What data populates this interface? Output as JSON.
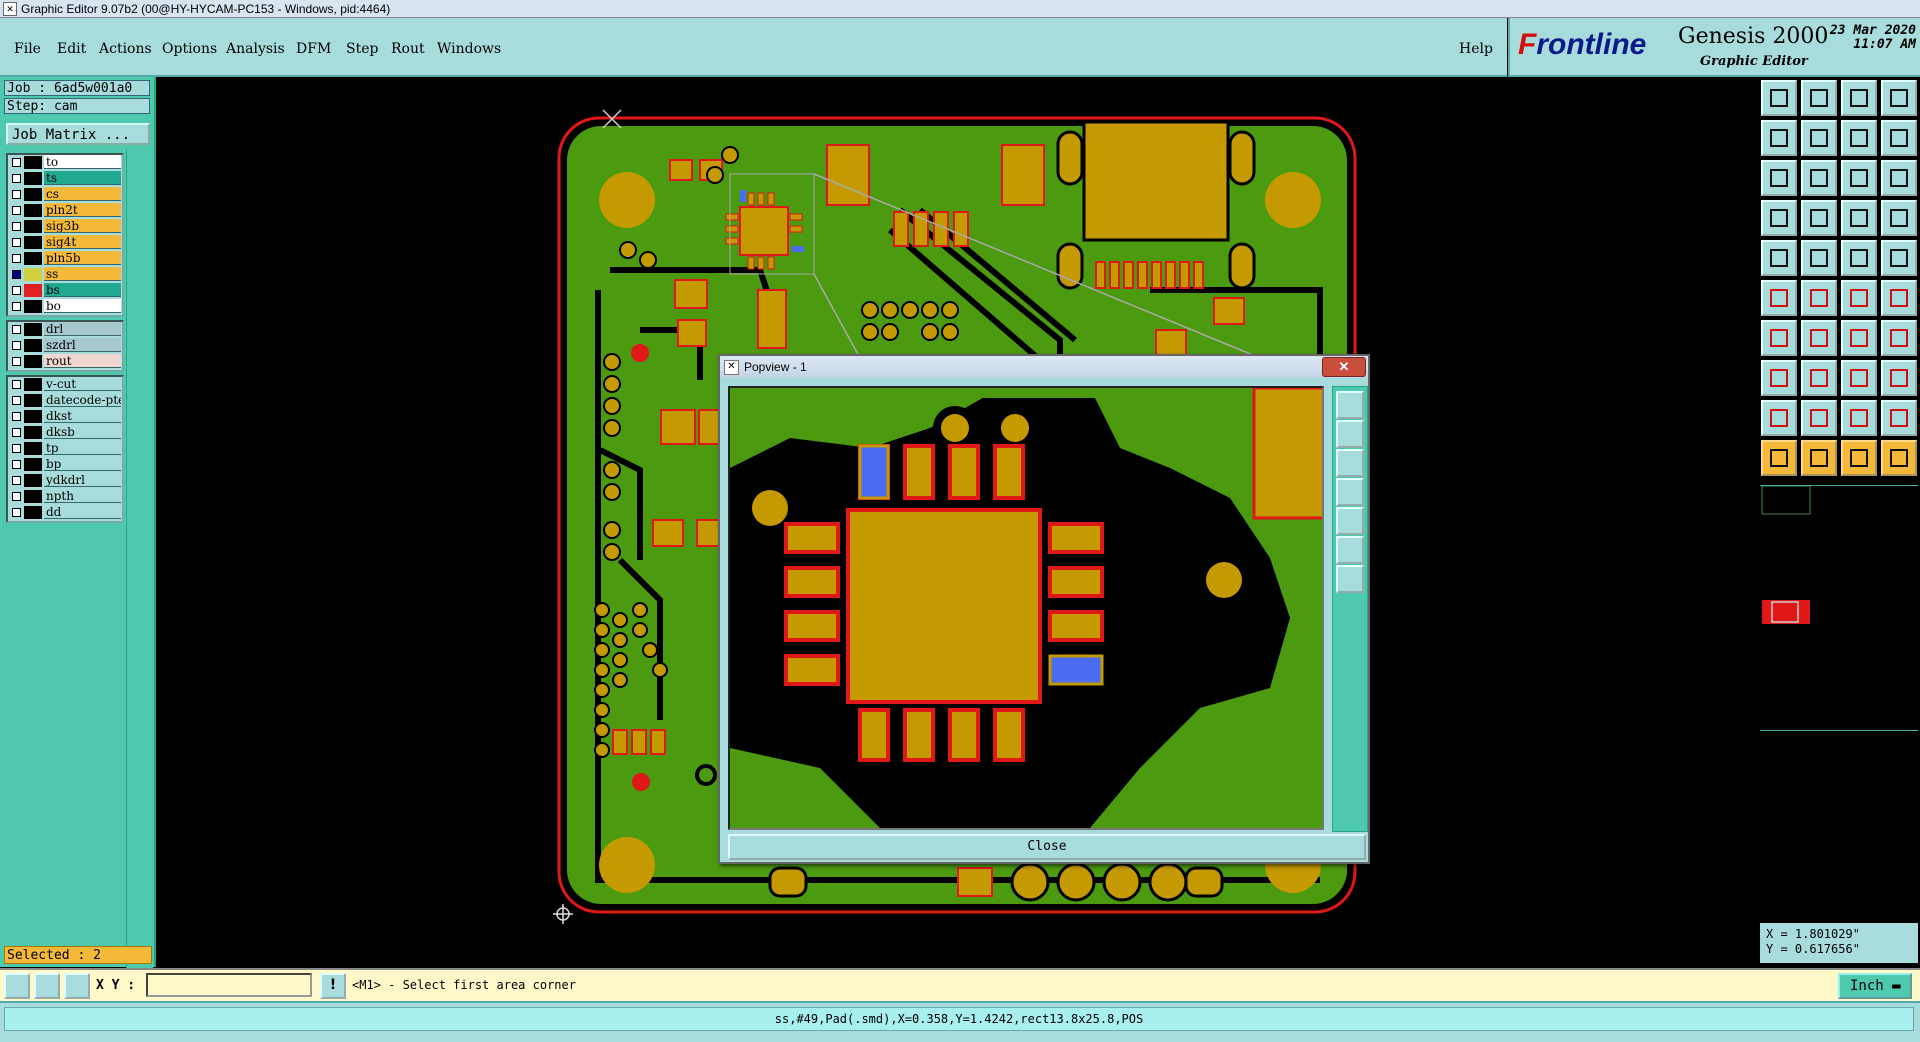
{
  "window": {
    "title": "Graphic Editor 9.07b2 (00@HY-HYCAM-PC153 - Windows, pid:4464)"
  },
  "menu": {
    "items": [
      "File",
      "Edit",
      "Actions",
      "Options",
      "Analysis",
      "DFM",
      "Step",
      "Rout",
      "Windows"
    ],
    "help": "Help"
  },
  "brand": {
    "logo_f": "F",
    "logo_rest": "rontline",
    "product": "Genesis 2000",
    "subtitle": "Graphic Editor",
    "date": "23 Mar 2020",
    "time": "11:07 AM"
  },
  "job": {
    "job_label": "Job : 6ad5w001a0",
    "step_label": "Step: cam",
    "matrix_button": "Job Matrix ..."
  },
  "layers": {
    "group1": [
      {
        "name": "to",
        "color": "#ffffff",
        "checked": false,
        "swatch": ""
      },
      {
        "name": "ts",
        "color": "#20a890",
        "checked": false,
        "swatch": ""
      },
      {
        "name": "cs",
        "color": "#f5b93a",
        "checked": false,
        "swatch": ""
      },
      {
        "name": "pln2t",
        "color": "#f5b93a",
        "checked": false,
        "swatch": ""
      },
      {
        "name": "sig3b",
        "color": "#f5b93a",
        "checked": false,
        "swatch": ""
      },
      {
        "name": "sig4t",
        "color": "#f5b93a",
        "checked": false,
        "swatch": ""
      },
      {
        "name": "pln5b",
        "color": "#f5b93a",
        "checked": false,
        "swatch": ""
      },
      {
        "name": "ss",
        "color": "#f5b93a",
        "checked": true,
        "swatch": "#d0d040"
      },
      {
        "name": "bs",
        "color": "#20a890",
        "checked": false,
        "swatch": "#e02020"
      },
      {
        "name": "bo",
        "color": "#ffffff",
        "checked": false,
        "swatch": ""
      }
    ],
    "group2": [
      {
        "name": "drl",
        "color": "#a8c8d0"
      },
      {
        "name": "szdrl",
        "color": "#a8c8d0"
      },
      {
        "name": "rout",
        "color": "#f0d8d0"
      }
    ],
    "group3": [
      {
        "name": "v-cut",
        "color": "#a8dcdc"
      },
      {
        "name": "datecode-pte",
        "color": "#a8dcdc"
      },
      {
        "name": "dkst",
        "color": "#a8dcdc"
      },
      {
        "name": "dksb",
        "color": "#a8dcdc"
      },
      {
        "name": "tp",
        "color": "#a8dcdc"
      },
      {
        "name": "bp",
        "color": "#a8dcdc"
      },
      {
        "name": "ydkdrl",
        "color": "#a8dcdc"
      },
      {
        "name": "npth",
        "color": "#a8dcdc"
      },
      {
        "name": "dd",
        "color": "#a8dcdc"
      }
    ]
  },
  "selection": {
    "label": "Selected : 2"
  },
  "popview": {
    "title": "Popview - 1",
    "close_label": "Close"
  },
  "coords": {
    "x": "X = 1.801029\"",
    "y": "Y = 0.617656\""
  },
  "cmdbar": {
    "xy_label": "X Y :",
    "xy_value": "",
    "prompt": "<M1> - Select first area corner",
    "units": "Inch"
  },
  "status": {
    "text": "ss,#49,Pad(.smd),X=0.358,Y=1.4242,rect13.8x25.8,POS"
  },
  "colors": {
    "board": "#4c9a10",
    "copper": "#c49a00",
    "outline": "#e01818",
    "selected": "#4a6cf0",
    "panel": "#a8dcdc",
    "accent": "#4fc9ad"
  }
}
